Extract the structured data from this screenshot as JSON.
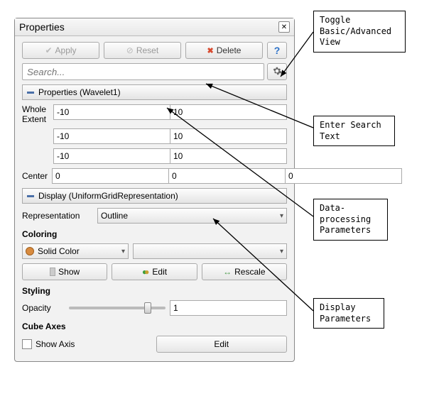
{
  "panel": {
    "title": "Properties",
    "buttons": {
      "apply": "Apply",
      "reset": "Reset",
      "delete": "Delete"
    },
    "search_placeholder": "Search...",
    "sections": {
      "props_header": "Properties (Wavelet1)",
      "display_header": "Display (UniformGridRepresentation)"
    },
    "whole_extent": {
      "label": "Whole Extent",
      "rows": [
        {
          "lo": "-10",
          "hi": "10"
        },
        {
          "lo": "-10",
          "hi": "10"
        },
        {
          "lo": "-10",
          "hi": "10"
        }
      ]
    },
    "center": {
      "label": "Center",
      "x": "0",
      "y": "0",
      "z": "0"
    },
    "representation": {
      "label": "Representation",
      "value": "Outline"
    },
    "coloring": {
      "label": "Coloring",
      "mode": "Solid Color",
      "show": "Show",
      "edit": "Edit",
      "rescale": "Rescale"
    },
    "styling": {
      "label": "Styling",
      "opacity_label": "Opacity",
      "opacity_value": "1"
    },
    "cube_axes": {
      "label": "Cube Axes",
      "show_axis": "Show Axis",
      "edit": "Edit"
    }
  },
  "annotations": {
    "toggle": "Toggle\nBasic/Advanced\nView",
    "search": "Enter Search\nText",
    "dataproc": "Data-\nprocessing\nParameters",
    "display": "Display\nParameters"
  }
}
